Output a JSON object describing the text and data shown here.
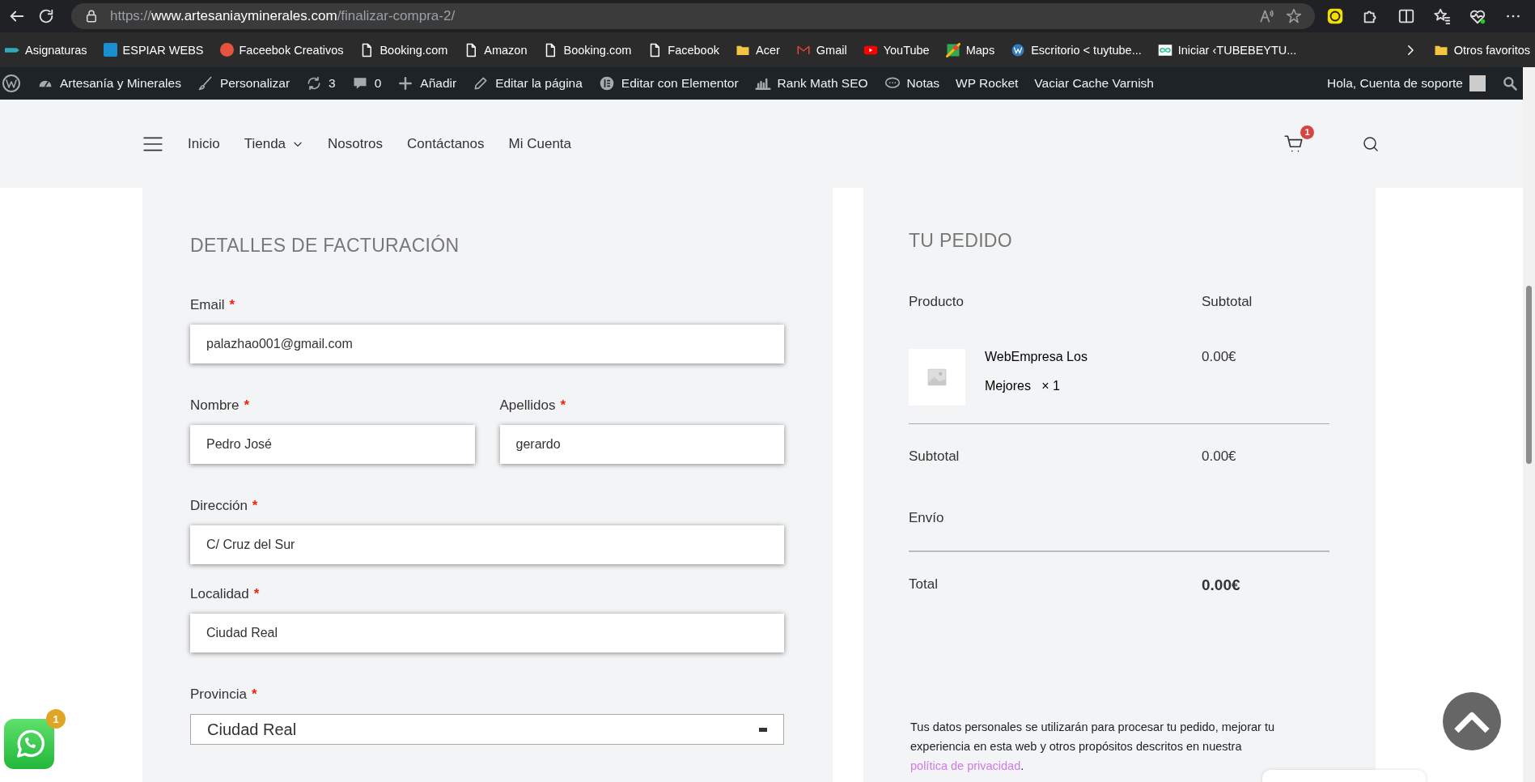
{
  "browser": {
    "address": {
      "scheme": "https://",
      "host": "www.artesaniayminerales.com",
      "path": "/finalizar-compra-2/"
    },
    "bookmarks": [
      {
        "label": "Asignaturas"
      },
      {
        "label": "ESPIAR WEBS"
      },
      {
        "label": "Faceebok Creativos"
      },
      {
        "label": "Booking.com"
      },
      {
        "label": "Amazon"
      },
      {
        "label": "Booking.com"
      },
      {
        "label": "Facebook"
      },
      {
        "label": "Acer"
      },
      {
        "label": "Gmail"
      },
      {
        "label": "YouTube"
      },
      {
        "label": "Maps"
      },
      {
        "label": "Escritorio < tuytube..."
      },
      {
        "label": "Iniciar ‹TUBEBEYTU..."
      }
    ],
    "other_favorites": "Otros favoritos"
  },
  "admin_bar": {
    "items": [
      {
        "label": "Artesanía y Minerales"
      },
      {
        "label": "Personalizar"
      },
      {
        "label": "3"
      },
      {
        "label": "0"
      },
      {
        "label": "Añadir"
      },
      {
        "label": "Editar la página"
      },
      {
        "label": "Editar con Elementor"
      },
      {
        "label": "Rank Math SEO"
      },
      {
        "label": "Notas"
      },
      {
        "label": "WP Rocket"
      },
      {
        "label": "Vaciar Cache Varnish"
      }
    ],
    "greeting": "Hola, Cuenta de soporte"
  },
  "site_nav": {
    "items": [
      {
        "label": "Inicio",
        "dropdown": false
      },
      {
        "label": "Tienda",
        "dropdown": true
      },
      {
        "label": "Nosotros",
        "dropdown": false
      },
      {
        "label": "Contáctanos",
        "dropdown": false
      },
      {
        "label": "Mi Cuenta",
        "dropdown": false
      }
    ],
    "cart_count": "1"
  },
  "billing": {
    "title": "DETALLES DE FACTURACIÓN",
    "rows": [
      [
        {
          "label": "Email",
          "required_mark": "*",
          "value": "palazhao001@gmail.com",
          "kind": "text"
        }
      ],
      [
        {
          "label": "Nombre",
          "required_mark": "*",
          "value": "Pedro José",
          "kind": "text"
        },
        {
          "label": "Apellidos",
          "required_mark": "*",
          "value": "gerardo",
          "kind": "text"
        }
      ],
      [
        {
          "label": "Dirección",
          "required_mark": "*",
          "value": "C/ Cruz del Sur",
          "kind": "text"
        }
      ],
      [
        {
          "label": "Localidad",
          "required_mark": "*",
          "value": "Ciudad Real",
          "kind": "text"
        }
      ],
      [
        {
          "label": "Provincia",
          "required_mark": "*",
          "value": "Ciudad Real",
          "kind": "select"
        }
      ]
    ]
  },
  "order": {
    "title": "TU PEDIDO",
    "columns": [
      "Producto",
      "Subtotal"
    ],
    "items": [
      {
        "name": "WebEmpresa Los Mejores",
        "quantity": "× 1",
        "price": "0.00€"
      }
    ],
    "totals": [
      {
        "label": "Subtotal",
        "value": "0.00€",
        "kind": "plain"
      },
      {
        "label": "Envío",
        "kind": "plain"
      },
      {
        "label": "Total",
        "value": "0.00€",
        "kind": "total"
      }
    ],
    "privacy": {
      "text": "Tus datos personales se utilizarán para procesar tu pedido, mejorar tu experiencia en esta web y otros propósitos descritos en nuestra",
      "link": "política de privacidad",
      "end": "."
    }
  },
  "whatsapp": {
    "badge": "1"
  }
}
